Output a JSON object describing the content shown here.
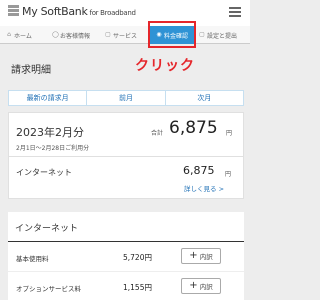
{
  "header": {
    "brand": "My SoftBank",
    "brand_sub": "for Broadband",
    "logo_icon": "softbank-logo",
    "menu_icon": "hamburger-menu-icon"
  },
  "nav": [
    {
      "label": "ホーム",
      "icon": "home-icon",
      "active": false
    },
    {
      "label": "お客様情報",
      "icon": "user-icon",
      "active": false
    },
    {
      "label": "サービス",
      "icon": "document-icon",
      "active": false
    },
    {
      "label": "料金確認",
      "icon": "yen-icon",
      "active": true
    },
    {
      "label": "設定と提出",
      "icon": "document-icon",
      "active": false
    }
  ],
  "annotation": {
    "click_label": "クリック",
    "color": "#e5262b"
  },
  "page_title": "請求明細",
  "tabs": [
    "最新の請求月",
    "前月",
    "次月"
  ],
  "summary": {
    "month": "2023年2月分",
    "period": "2月1日〜2月28日ご利用分",
    "total_label": "合計",
    "total_amount": "6,875",
    "total_unit": "円"
  },
  "internet_row": {
    "label": "インターネット",
    "amount": "6,875",
    "unit": "円",
    "detail_link": "詳しく見る >"
  },
  "section2": {
    "title": "インターネット",
    "rows": [
      {
        "name": "基本使用料",
        "amount": "5,720円",
        "button": "内訳"
      },
      {
        "name": "オプションサービス料",
        "amount": "1,155円",
        "button": "内訳"
      }
    ]
  },
  "colors": {
    "accent": "#2f93d5",
    "link": "#1e6fb5",
    "highlight": "#e5262b"
  }
}
